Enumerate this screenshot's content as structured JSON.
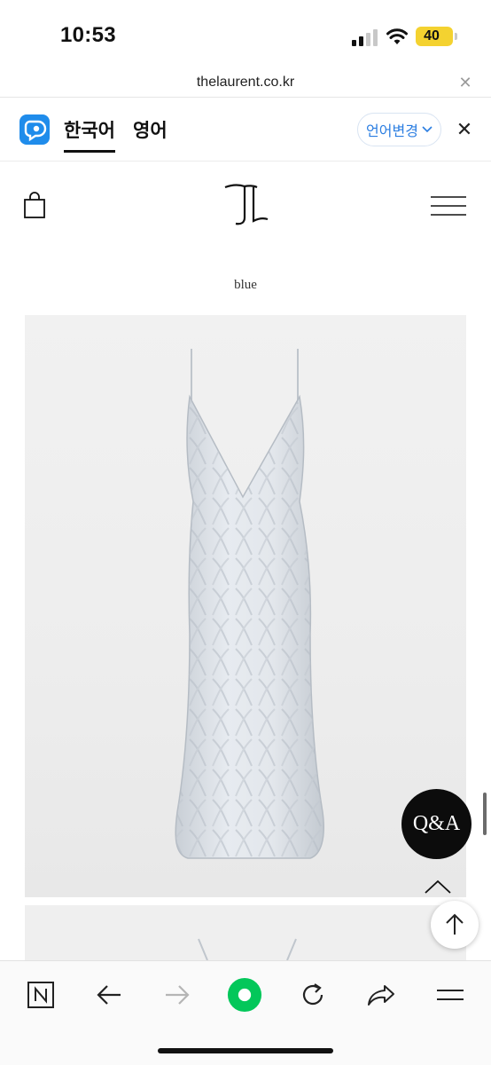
{
  "status_bar": {
    "time": "10:53",
    "battery": "40"
  },
  "browser": {
    "url": "thelaurent.co.kr"
  },
  "translate_bar": {
    "tab_korean": "한국어",
    "tab_english": "영어",
    "change_language": "언어변경"
  },
  "page": {
    "color_label": "blue"
  },
  "floating": {
    "qa_label": "Q&A"
  },
  "colors": {
    "papago_blue": "#1f8ceb",
    "link_blue": "#2a7de1",
    "accent_green": "#03c75a",
    "battery_yellow": "#f4d230"
  },
  "icons": {
    "bag": "shopping-bag-icon",
    "menu": "hamburger-menu-icon",
    "back": "arrow-left-icon",
    "forward": "arrow-right-icon",
    "reload": "reload-icon",
    "share": "share-icon",
    "more": "menu-icon",
    "naver": "naver-n-icon"
  }
}
